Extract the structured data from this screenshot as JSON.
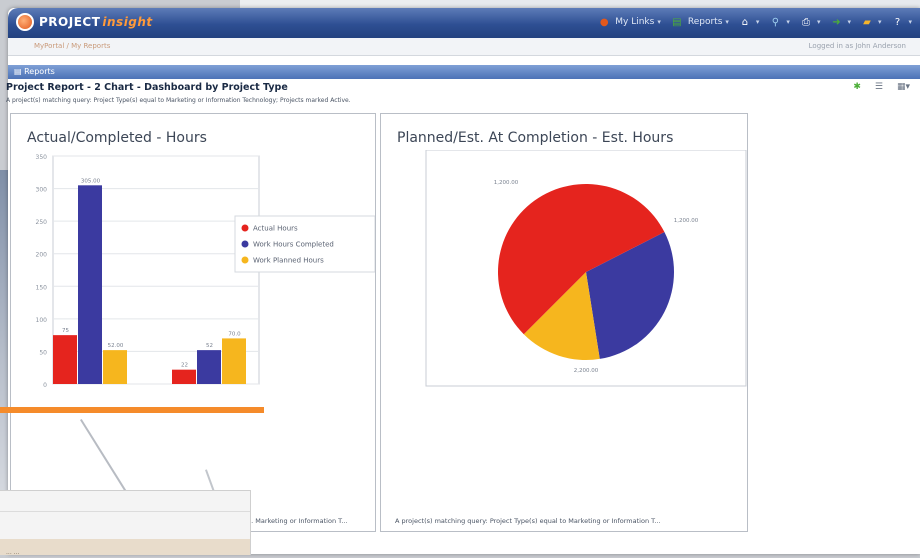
{
  "app": {
    "logo_text": "PROJECT",
    "logo_accent": "insight"
  },
  "toolbar": {
    "items": [
      {
        "label": "My Links",
        "icon": "globe-icon",
        "color": "#e2581c"
      },
      {
        "label": "Reports",
        "icon": "document-icon",
        "color": "#4cae38"
      },
      {
        "label": "",
        "icon": "home-icon",
        "color": "#ffffff"
      },
      {
        "label": "",
        "icon": "search-icon",
        "color": "#9fd0f0"
      },
      {
        "label": "",
        "icon": "print-icon",
        "color": "#ffffff"
      },
      {
        "label": "",
        "icon": "arrow-icon",
        "color": "#4cae38"
      },
      {
        "label": "",
        "icon": "folder-icon",
        "color": "#f5b42a"
      },
      {
        "label": "",
        "icon": "help-icon",
        "color": "#ffffff"
      }
    ]
  },
  "subheader": {
    "breadcrumb": "MyPortal / My Reports",
    "login": "Logged in as John Anderson"
  },
  "section": {
    "label": "Reports"
  },
  "report": {
    "title": "Project Report - 2 Chart - Dashboard by Project Type",
    "subtitle": "A project(s) matching query: Project Type(s) equal to Marketing or Information Technology; Projects marked Active.",
    "footnote_left": "... Marketing or Information T...",
    "footnote_right": "A project(s) matching query: Project Type(s) equal to Marketing or Information T..."
  },
  "bottom_overlay": {
    "text": "... ..."
  },
  "chart_data": [
    {
      "type": "bar",
      "title": "Actual/Completed - Hours",
      "categories": [
        "",
        ""
      ],
      "ylim": [
        0,
        350
      ],
      "yticks": [
        0,
        50,
        100,
        150,
        200,
        250,
        300,
        350
      ],
      "grid": true,
      "legend_position": "right",
      "series": [
        {
          "name": "Actual Hours",
          "color": "#e5241e",
          "values": [
            75,
            22
          ],
          "labels": [
            "75",
            "22"
          ]
        },
        {
          "name": "Work Hours Completed",
          "color": "#3b3aa0",
          "values": [
            305,
            52
          ],
          "labels": [
            "305.00",
            "52"
          ]
        },
        {
          "name": "Work Planned Hours",
          "color": "#f6b61e",
          "values": [
            52,
            70
          ],
          "labels": [
            "52.00",
            "70.0"
          ]
        }
      ]
    },
    {
      "type": "pie",
      "title": "Planned/Est. At Completion - Est. Hours",
      "slices": [
        {
          "label": "1,200.00",
          "value": 1200,
          "color": "#3b3aa0"
        },
        {
          "label": "1,200.00",
          "value": 600,
          "color": "#f6b61e"
        },
        {
          "label": "2,200.00",
          "value": 2200,
          "color": "#e5241e"
        }
      ]
    }
  ]
}
